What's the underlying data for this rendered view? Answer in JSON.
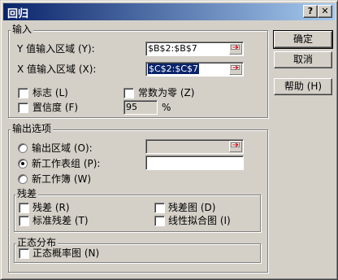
{
  "window": {
    "title": "回归",
    "help_btn": "?",
    "close_btn": "✕"
  },
  "input": {
    "legend": "输入",
    "y_label": "Y 值输入区域 (Y):",
    "y_value": "$B$2:$B$7",
    "x_label": "X 值输入区域 (X):",
    "x_value": "$C$2:$C$7",
    "labels_label": "标志 (L)",
    "constant_zero_label": "常数为零 (Z)",
    "confidence_label": "置信度 (F)",
    "confidence_value": "95",
    "percent": "%"
  },
  "output": {
    "legend": "输出选项",
    "output_range_label": "输出区域 (O):",
    "output_range_value": "",
    "new_sheet_label": "新工作表组 (P):",
    "new_sheet_value": "",
    "new_workbook_label": "新工作簿 (W)",
    "selected": "new_sheet"
  },
  "residuals": {
    "legend": "残差",
    "residuals_label": "残差 (R)",
    "residual_plots_label": "残差图 (D)",
    "standardized_label": "标准残差 (T)",
    "line_fit_label": "线性拟合图 (I)"
  },
  "normal": {
    "legend": "正态分布",
    "probability_plots_label": "正态概率图 (N)"
  },
  "buttons": {
    "ok": "确定",
    "cancel": "取消",
    "help": "帮助 (H)"
  }
}
